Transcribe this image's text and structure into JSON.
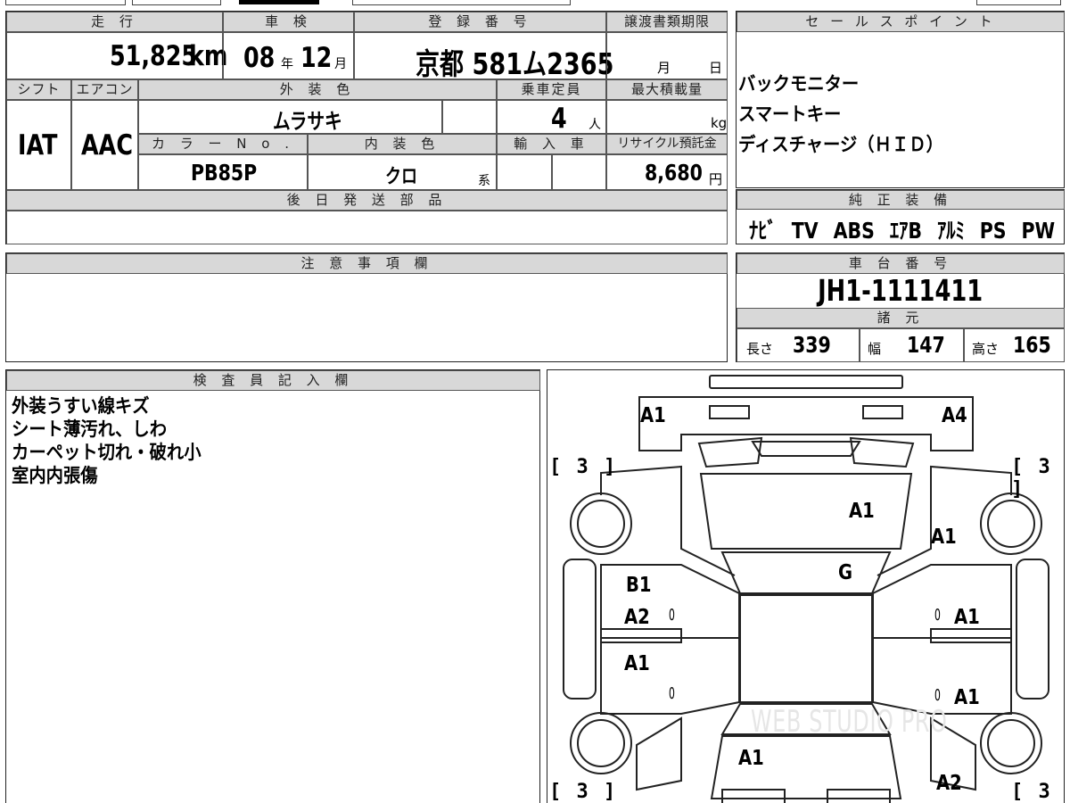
{
  "top": {
    "headers": {
      "mileage": "走 行",
      "inspection": "車 検",
      "registration": "登 録 番 号",
      "transfer_deadline": "譲渡書類期限",
      "sales_point": "セ ー ル ス ポ イ ン ト"
    },
    "mileage_value": "51,825",
    "mileage_unit": "km",
    "inspection_year": "08",
    "inspection_year_unit": "年",
    "inspection_month": "12",
    "inspection_month_unit": "月",
    "registration_value": "京都 581ム2365",
    "transfer_month_unit": "月",
    "transfer_day_unit": "日"
  },
  "specs": {
    "headers": {
      "shift": "シフト",
      "aircon": "エアコン",
      "exterior_color": "外 装 色",
      "capacity": "乗車定員",
      "max_load": "最大積載量",
      "color_no": "カ ラ ー N o .",
      "interior_color": "内 装 色",
      "import": "輸 入 車",
      "recycle": "リサイクル預託金"
    },
    "shift_value": "IAT",
    "aircon_value": "AAC",
    "exterior_color_value": "ムラサキ",
    "capacity_value": "4",
    "capacity_unit": "人",
    "max_load_unit": "kg",
    "color_no_value": "PB85P",
    "interior_color_value": "クロ",
    "interior_color_unit": "系",
    "recycle_value": "8,680",
    "recycle_unit": "円"
  },
  "sales_points": [
    "バックモニター",
    "スマートキー",
    "ディスチャージ（ＨＩＤ）"
  ],
  "later_parts": {
    "header": "後 日 発 送 部 品",
    "value": ""
  },
  "genuine_equipment": {
    "header": "純 正 装 備",
    "items": [
      "ﾅﾋﾞ",
      "TV",
      "ABS",
      "ｴｱB",
      "ｱﾙﾐ",
      "PS",
      "PW"
    ]
  },
  "notes": {
    "header": "注 意 事 項 欄",
    "value": ""
  },
  "chassis": {
    "header": "車 台 番 号",
    "value": "JH1-1111411"
  },
  "dimensions": {
    "header": "諸 元",
    "length_label": "長さ",
    "length_value": "339",
    "width_label": "幅",
    "width_value": "147",
    "height_label": "高さ",
    "height_value": "165"
  },
  "inspector": {
    "header": "検 査 員 記 入 欄",
    "lines": [
      "外装うすい線キズ",
      "シート薄汚れ、しわ",
      "カーペット切れ・破れ小",
      "室内内張傷"
    ]
  },
  "diagram": {
    "brackets": [
      "[ 3 ]",
      "[ 3 ]",
      "[ 3 ]",
      "[ 3 ]"
    ],
    "marks": {
      "front_left": "A1",
      "front_right": "A4",
      "hood": "A1",
      "front_fender_right": "A1",
      "windshield": "G",
      "door_fl_1": "B1",
      "door_fl_2": "A2",
      "door_rl": "A1",
      "door_fr": "A1",
      "door_rr": "A1",
      "rear": "A1",
      "rear_right": "A2",
      "zero": "0"
    },
    "watermark": "WEB STUDIO PRO"
  }
}
